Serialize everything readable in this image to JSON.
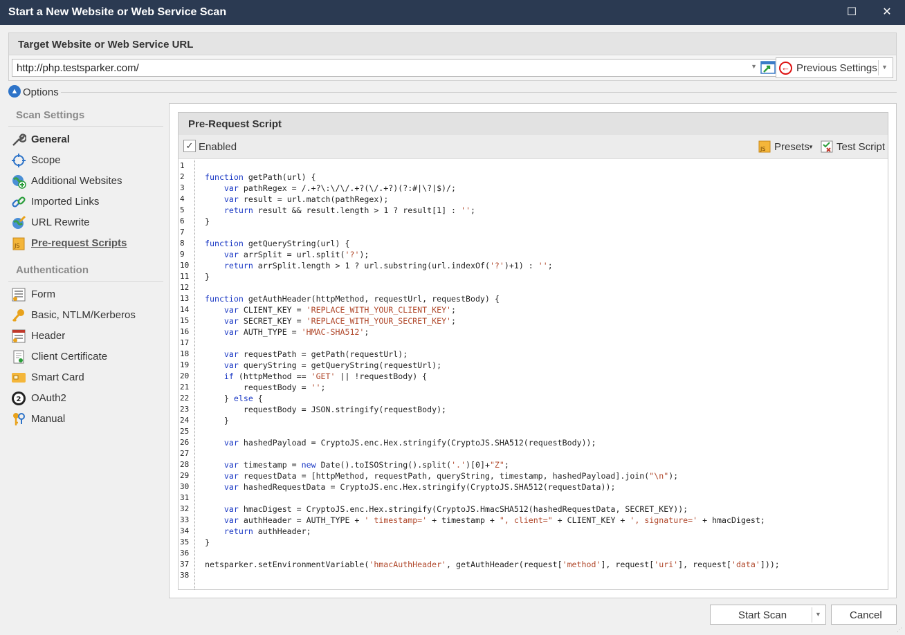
{
  "window": {
    "title": "Start a New Website or Web Service Scan",
    "maximize": "☐",
    "close": "✕"
  },
  "target": {
    "header": "Target Website or Web Service URL",
    "url": "http://php.testsparker.com/",
    "previous_settings": "Previous Settings"
  },
  "options": {
    "label": "Options"
  },
  "sidebar": {
    "scan_settings_title": "Scan Settings",
    "scan_items": [
      {
        "label": "General",
        "icon": "wrench-icon"
      },
      {
        "label": "Scope",
        "icon": "target-icon"
      },
      {
        "label": "Additional Websites",
        "icon": "globe-plus-icon"
      },
      {
        "label": "Imported Links",
        "icon": "link-icon"
      },
      {
        "label": "URL Rewrite",
        "icon": "globe-pencil-icon"
      },
      {
        "label": "Pre-request Scripts",
        "icon": "js-file-icon"
      }
    ],
    "auth_title": "Authentication",
    "auth_items": [
      {
        "label": "Form",
        "icon": "form-icon"
      },
      {
        "label": "Basic, NTLM/Kerberos",
        "icon": "key-icon"
      },
      {
        "label": "Header",
        "icon": "header-icon"
      },
      {
        "label": "Client Certificate",
        "icon": "certificate-icon"
      },
      {
        "label": "Smart Card",
        "icon": "smart-card-icon"
      },
      {
        "label": "OAuth2",
        "icon": "oauth2-icon"
      },
      {
        "label": "Manual",
        "icon": "keys-icon"
      }
    ]
  },
  "script_panel": {
    "header": "Pre-Request Script",
    "enabled_label": "Enabled",
    "enabled_check": "✓",
    "presets_label": "Presets",
    "test_script_label": "Test Script",
    "line_numbers": [
      "1",
      "2",
      "3",
      "4",
      "5",
      "6",
      "7",
      "8",
      "9",
      "10",
      "11",
      "12",
      "13",
      "14",
      "15",
      "16",
      "17",
      "18",
      "19",
      "20",
      "21",
      "22",
      "23",
      "24",
      "25",
      "26",
      "27",
      "28",
      "29",
      "30",
      "31",
      "32",
      "33",
      "34",
      "35",
      "36",
      "37",
      "38"
    ],
    "code_lines": [
      "",
      "function getPath(url) {",
      "    var pathRegex = /.+?\\:\\/\\/.+?(\\/.+?)(?:#|\\?|$)/;",
      "    var result = url.match(pathRegex);",
      "    return result && result.length > 1 ? result[1] : '';",
      "}",
      "",
      "function getQueryString(url) {",
      "    var arrSplit = url.split('?');",
      "    return arrSplit.length > 1 ? url.substring(url.indexOf('?')+1) : '';",
      "}",
      "",
      "function getAuthHeader(httpMethod, requestUrl, requestBody) {",
      "    var CLIENT_KEY = 'REPLACE_WITH_YOUR_CLIENT_KEY';",
      "    var SECRET_KEY = 'REPLACE_WITH_YOUR_SECRET_KEY';",
      "    var AUTH_TYPE = 'HMAC-SHA512';",
      "",
      "    var requestPath = getPath(requestUrl);",
      "    var queryString = getQueryString(requestUrl);",
      "    if (httpMethod == 'GET' || !requestBody) {",
      "        requestBody = '';",
      "    } else {",
      "        requestBody = JSON.stringify(requestBody);",
      "    }",
      "",
      "    var hashedPayload = CryptoJS.enc.Hex.stringify(CryptoJS.SHA512(requestBody));",
      "",
      "    var timestamp = new Date().toISOString().split('.')[0]+\"Z\";",
      "    var requestData = [httpMethod, requestPath, queryString, timestamp, hashedPayload].join(\"\\n\");",
      "    var hashedRequestData = CryptoJS.enc.Hex.stringify(CryptoJS.SHA512(requestData));",
      "",
      "    var hmacDigest = CryptoJS.enc.Hex.stringify(CryptoJS.HmacSHA512(hashedRequestData, SECRET_KEY));",
      "    var authHeader = AUTH_TYPE + ' timestamp=' + timestamp + \", client=\" + CLIENT_KEY + ', signature=' + hmacDigest;",
      "    return authHeader;",
      "}",
      "",
      "netsparker.setEnvironmentVariable('hmacAuthHeader', getAuthHeader(request['method'], request['uri'], request['data']));",
      ""
    ]
  },
  "footer": {
    "start_scan": "Start Scan",
    "cancel": "Cancel"
  },
  "colors": {
    "titlebar": "#2b3a52",
    "keyword": "#1a38c4",
    "string": "#b0482b",
    "accent": "#2d73c8"
  }
}
